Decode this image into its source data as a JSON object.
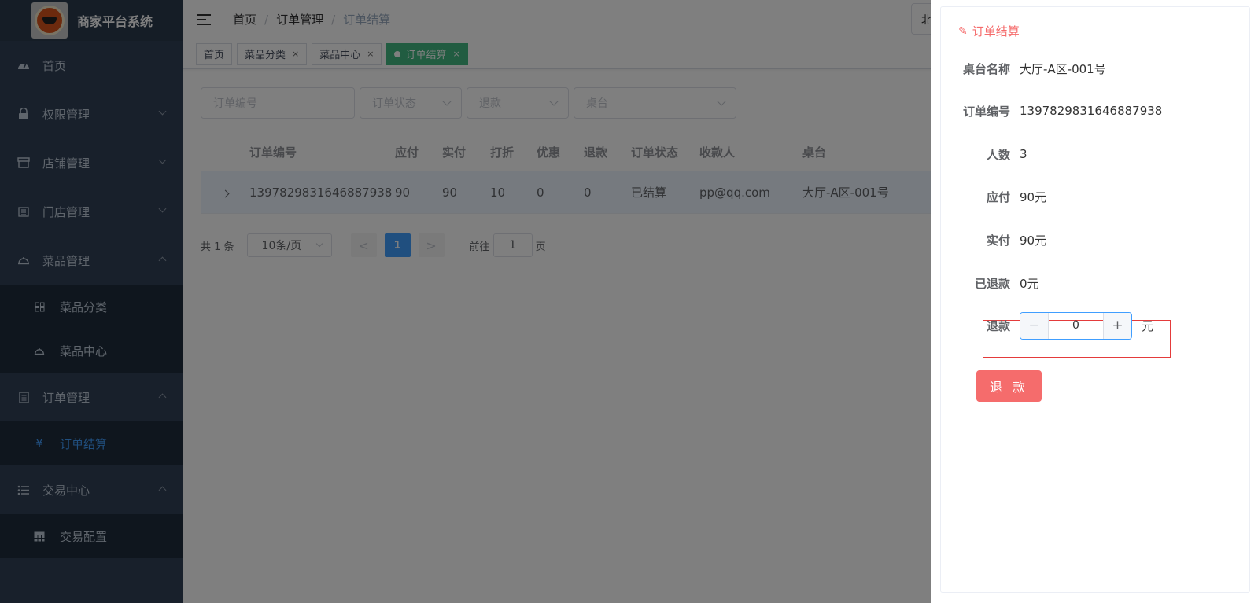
{
  "brand": {
    "title": "商家平台系统",
    "logo_icon": "mascot-logo"
  },
  "sidebar": {
    "items": [
      {
        "label": "首页",
        "icon": "dashboard-icon"
      },
      {
        "label": "权限管理",
        "icon": "lock-icon"
      },
      {
        "label": "店铺管理",
        "icon": "shop-icon"
      },
      {
        "label": "门店管理",
        "icon": "store-icon"
      },
      {
        "label": "菜品管理",
        "icon": "dish-icon"
      },
      {
        "label": "订单管理",
        "icon": "document-icon"
      },
      {
        "label": "交易中心",
        "icon": "list-icon"
      }
    ],
    "dish_sub": [
      {
        "label": "菜品分类",
        "icon": "grid-icon"
      },
      {
        "label": "菜品中心",
        "icon": "dish-icon"
      }
    ],
    "order_sub": [
      {
        "label": "订单结算",
        "icon": "yen-icon"
      }
    ],
    "trade_sub": [
      {
        "label": "交易配置",
        "icon": "table-icon"
      }
    ]
  },
  "breadcrumb": [
    "首页",
    "订单管理",
    "订单结算"
  ],
  "nav_right": "北",
  "tags": [
    {
      "label": "首页"
    },
    {
      "label": "菜品分类",
      "close": "×"
    },
    {
      "label": "菜品中心",
      "close": "×"
    },
    {
      "label": "订单结算",
      "close": "×"
    }
  ],
  "filters": {
    "order_no": "订单编号",
    "order_status": "订单状态",
    "refund": "退款",
    "table": "桌台"
  },
  "table": {
    "headers": [
      "订单编号",
      "应付",
      "实付",
      "打折",
      "优惠",
      "退款",
      "订单状态",
      "收款人",
      "桌台"
    ],
    "rows": [
      [
        "1397829831646887938",
        "90",
        "90",
        "10",
        "0",
        "0",
        "已结算",
        "pp@qq.com",
        "大厅-A区-001号"
      ]
    ]
  },
  "pagination": {
    "total": "共 1 条",
    "page_size": "10条/页",
    "prev": "<",
    "current": "1",
    "next": ">",
    "goto_prefix": "前往",
    "goto_value": "1",
    "goto_suffix": "页"
  },
  "drawer": {
    "title": "订单结算",
    "fields": [
      {
        "label": "桌台名称",
        "value": "大厅-A区-001号"
      },
      {
        "label": "订单编号",
        "value": "1397829831646887938"
      },
      {
        "label": "人数",
        "value": "3"
      },
      {
        "label": "应付",
        "value": "90元"
      },
      {
        "label": "实付",
        "value": "90元"
      },
      {
        "label": "已退款",
        "value": "0元"
      }
    ],
    "refund_label": "退款",
    "refund_value": "0",
    "refund_unit": "元",
    "minus": "−",
    "plus": "+",
    "refund_button": "退 款"
  },
  "colors": {
    "sidebar_bg": "#304156",
    "accent": "#409eff",
    "active_tag": "#42b983",
    "danger": "#f56c6c"
  }
}
